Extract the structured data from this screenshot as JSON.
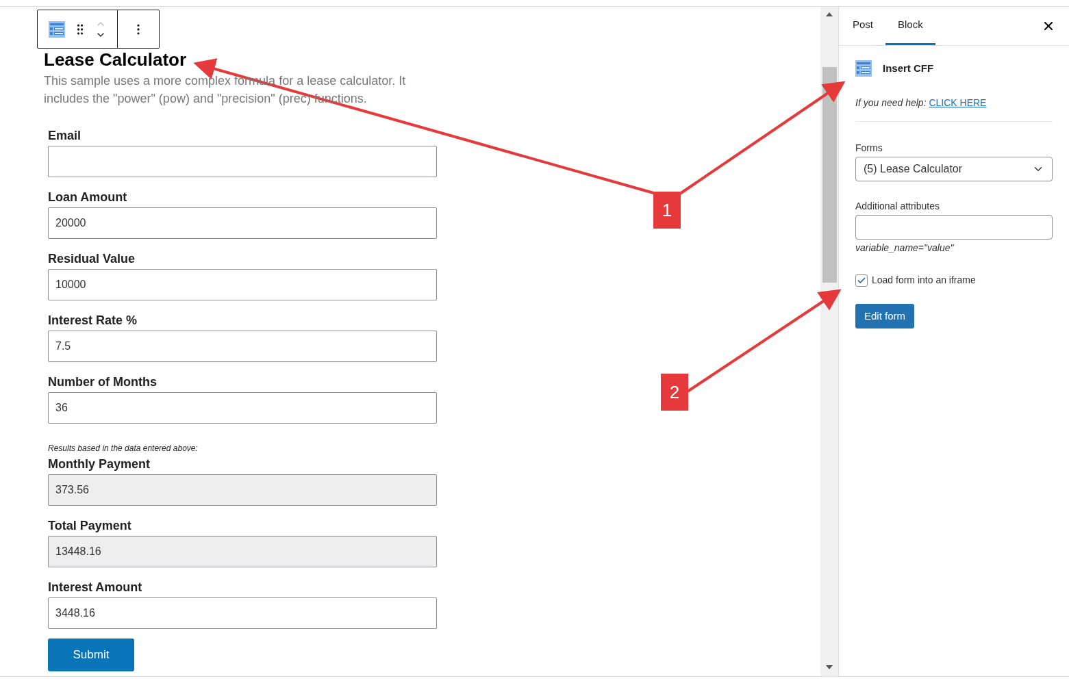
{
  "editor": {
    "title": "Lease Calculator",
    "description": "This sample uses a more complex formula for a lease calculator. It includes the \"power\" (pow) and \"precision\" (prec) functions.",
    "fields": [
      {
        "label": "Email",
        "readonly": false
      },
      {
        "label": "Loan Amount",
        "value": "20000",
        "readonly": false
      },
      {
        "label": "Residual Value",
        "value": "10000",
        "readonly": false
      },
      {
        "label": "Interest Rate %",
        "value": "7.5",
        "readonly": false
      },
      {
        "label": "Number of Months",
        "value": "36",
        "readonly": false
      },
      {
        "kind": "note",
        "text": "Results based in the data entered above:"
      },
      {
        "label": "Monthly Payment",
        "value": "373.56",
        "readonly": true
      },
      {
        "label": "Total Payment",
        "value": "13448.16",
        "readonly": true
      },
      {
        "label": "Interest Amount",
        "value": "3448.16",
        "readonly": false
      }
    ],
    "submit": "Submit"
  },
  "annotations": [
    {
      "number": "1"
    },
    {
      "number": "2"
    }
  ],
  "sidebar": {
    "tabs": [
      {
        "label": "Post",
        "selected": false
      },
      {
        "label": "Block",
        "selected": true
      }
    ],
    "block_name": "Insert CFF",
    "help_text": "If you need help:",
    "help_link": "CLICK HERE",
    "forms_label": "Forms",
    "forms_value": "(5) Lease Calculator",
    "attributes_label": "Additional attributes",
    "attributes_hint": "variable_name=\"value\"",
    "iframe": {
      "label": "Load form into an iframe",
      "checked": true
    },
    "edit_button": "Edit form"
  }
}
